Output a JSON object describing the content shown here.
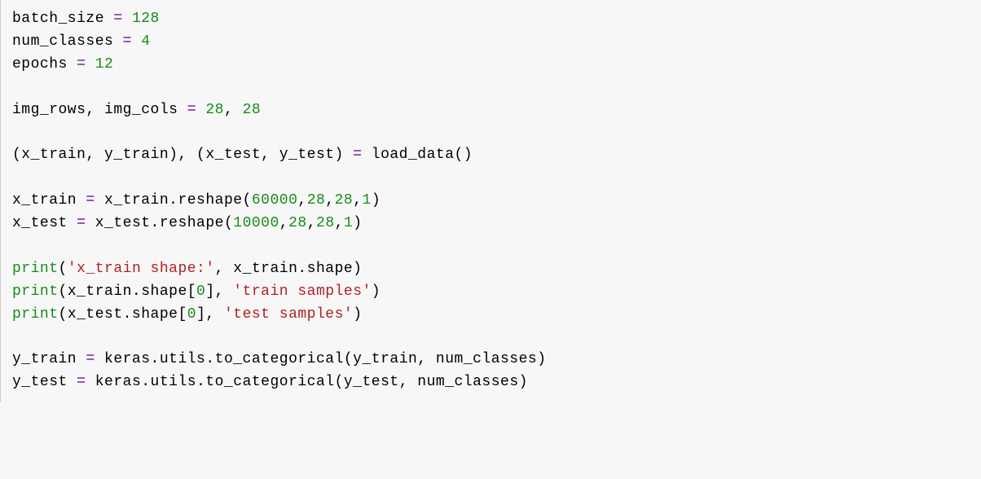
{
  "code": {
    "l1_batch_size": "batch_size",
    "l1_eq": " = ",
    "l1_val": "128",
    "l2_num_classes": "num_classes",
    "l2_eq": " = ",
    "l2_val": "4",
    "l3_epochs": "epochs",
    "l3_eq": " = ",
    "l3_val": "12",
    "l5_imgrows": "img_rows",
    "l5_comma": ", ",
    "l5_imgcols": "img_cols",
    "l5_eq": " = ",
    "l5_v1": "28",
    "l5_c2": ", ",
    "l5_v2": "28",
    "l7_text": "(x_train, y_train), (x_test, y_test) ",
    "l7_eq": "= ",
    "l7_call": "load_data()",
    "l9_xtrain": "x_train ",
    "l9_eq": "= ",
    "l9_mid": "x_train.reshape(",
    "l9_n1": "60000",
    "l9_c1": ",",
    "l9_n2": "28",
    "l9_c2": ",",
    "l9_n3": "28",
    "l9_c3": ",",
    "l9_n4": "1",
    "l9_close": ")",
    "l10_xtest": "x_test ",
    "l10_eq": "= ",
    "l10_mid": "x_test.reshape(",
    "l10_n1": "10000",
    "l10_c1": ",",
    "l10_n2": "28",
    "l10_c2": ",",
    "l10_n3": "28",
    "l10_c3": ",",
    "l10_n4": "1",
    "l10_close": ")",
    "l12_print": "print",
    "l12_open": "(",
    "l12_s": "'x_train shape:'",
    "l12_rest": ", x_train.shape)",
    "l13_print": "print",
    "l13_a": "(x_train.shape[",
    "l13_zero": "0",
    "l13_b": "], ",
    "l13_s": "'train samples'",
    "l13_close": ")",
    "l14_print": "print",
    "l14_a": "(x_test.shape[",
    "l14_zero": "0",
    "l14_b": "], ",
    "l14_s": "'test samples'",
    "l14_close": ")",
    "l16_ytrain": "y_train ",
    "l16_eq": "= ",
    "l16_rest": "keras.utils.to_categorical(y_train, num_classes)",
    "l17_ytest": "y_test ",
    "l17_eq": "= ",
    "l17_rest": "keras.utils.to_categorical(y_test, num_classes)"
  }
}
